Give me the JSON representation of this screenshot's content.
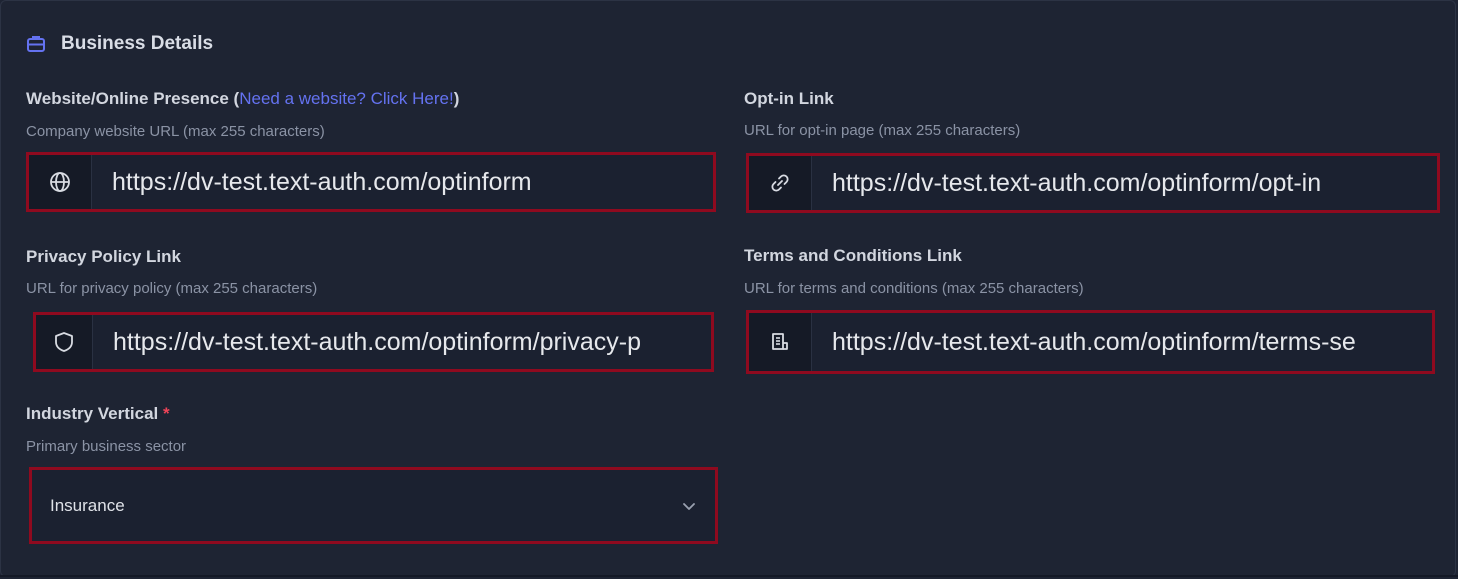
{
  "section": {
    "title": "Business Details",
    "icon": "briefcase-icon",
    "accent": "#6472f0"
  },
  "website": {
    "label": "Website/Online Presence (",
    "link_text": "Need a website? Click Here!",
    "label_close": ")",
    "hint": "Company website URL (max 255 characters)",
    "value": "https://dv-test.text-auth.com/optinform",
    "icon": "globe-icon"
  },
  "optin": {
    "label": "Opt-in Link",
    "hint": "URL for opt-in page (max 255 characters)",
    "value": "https://dv-test.text-auth.com/optinform/opt-in",
    "icon": "link-icon"
  },
  "privacy": {
    "label": "Privacy Policy Link",
    "hint": "URL for privacy policy (max 255 characters)",
    "value": "https://dv-test.text-auth.com/optinform/privacy-p",
    "icon": "shield-icon"
  },
  "terms": {
    "label": "Terms and Conditions Link",
    "hint": "URL for terms and conditions (max 255 characters)",
    "value": "https://dv-test.text-auth.com/optinform/terms-se",
    "icon": "document-icon"
  },
  "industry": {
    "label": "Industry Vertical",
    "required_mark": "*",
    "hint": "Primary business sector",
    "selected": "Insurance",
    "icon": "chevron-down-icon"
  },
  "colors": {
    "background": "#1e2433",
    "highlight_border": "#8f0a1f",
    "link": "#6472f0",
    "required": "#ef4458"
  }
}
